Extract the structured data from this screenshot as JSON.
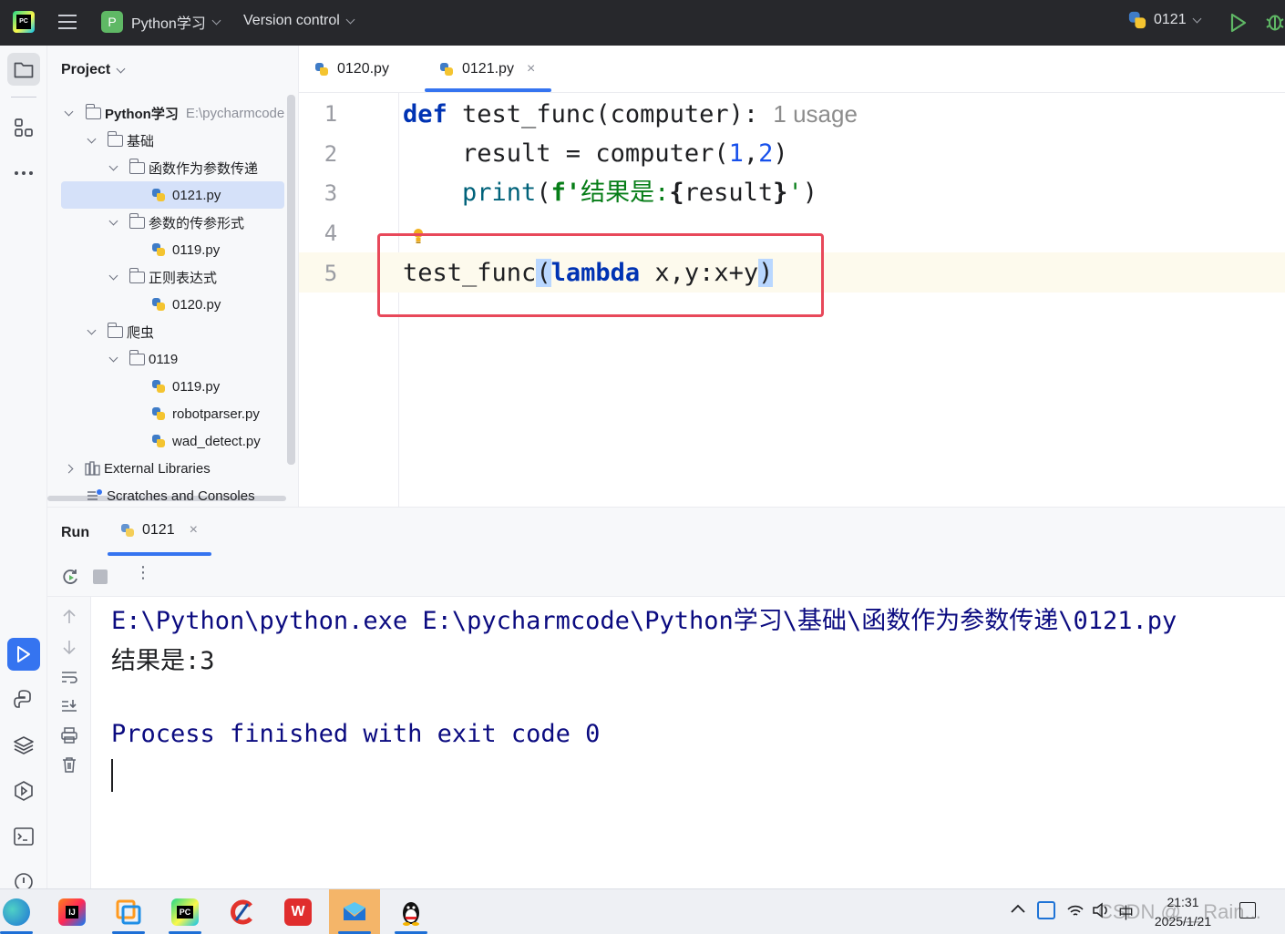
{
  "topbar": {
    "project_badge": "P",
    "project_name": "Python学习",
    "vcs_label": "Version control",
    "run_config": "0121"
  },
  "project_panel": {
    "title": "Project",
    "root_name": "Python学习",
    "root_path": "E:\\pycharmcode",
    "items": [
      {
        "label": "基础"
      },
      {
        "label": "函数作为参数传递"
      },
      {
        "label": "0121.py"
      },
      {
        "label": "参数的传参形式"
      },
      {
        "label": "0119.py"
      },
      {
        "label": "正则表达式"
      },
      {
        "label": "0120.py"
      },
      {
        "label": "爬虫"
      },
      {
        "label": "0119"
      },
      {
        "label": "0119.py"
      },
      {
        "label": "robotparser.py"
      },
      {
        "label": "wad_detect.py"
      },
      {
        "label": "External Libraries"
      },
      {
        "label": "Scratches and Consoles"
      }
    ]
  },
  "editor": {
    "tabs": [
      {
        "label": "0120.py"
      },
      {
        "label": "0121.py"
      }
    ],
    "line_numbers": [
      "1",
      "2",
      "3",
      "4",
      "5"
    ],
    "code": {
      "l1_kw": "def",
      "l1_rest": " test_func(computer): ",
      "l1_hint": "1 usage",
      "l2_a": "    result = computer(",
      "l2_n1": "1",
      "l2_comma": ",",
      "l2_n2": "2",
      "l2_close": ")",
      "l3_indent": "    ",
      "l3_fn": "print",
      "l3_open": "(",
      "l3_f": "f'",
      "l3_str": "结果是:",
      "l3_lb": "{",
      "l3_var": "result",
      "l3_rb": "}",
      "l3_q": "'",
      "l3_close": ")",
      "l5_a": "test_func",
      "l5_open": "(",
      "l5_kw": "lambda",
      "l5_body": " x,y:x+y",
      "l5_close": ")"
    }
  },
  "run": {
    "title": "Run",
    "tab_label": "0121",
    "output": [
      "E:\\Python\\python.exe E:\\pycharmcode\\Python学习\\基础\\函数作为参数传递\\0121.py",
      "结果是:3",
      "",
      "Process finished with exit code 0"
    ]
  },
  "taskbar": {
    "time": "21:31",
    "date": "2025/1/21",
    "ime": "中",
    "watermark": "CSDN @__Rain..."
  },
  "colors": {
    "highlight_box": "#e8485a",
    "keyword": "#0033b3",
    "console_text": "#0b0b80"
  }
}
